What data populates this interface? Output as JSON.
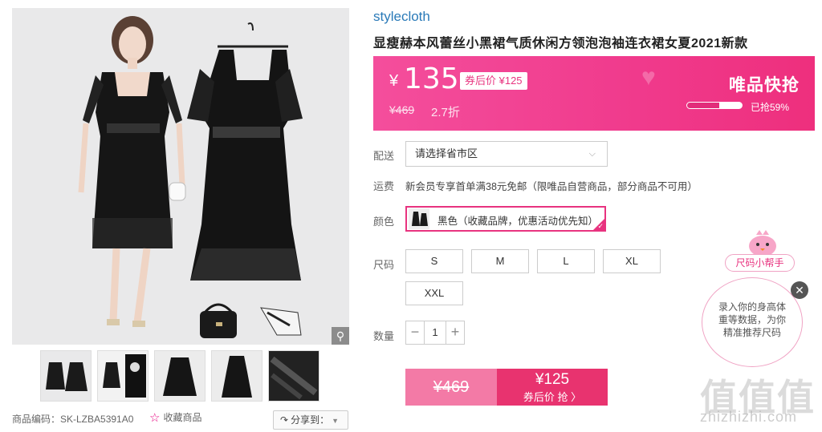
{
  "gallery": {
    "zoom_icon": "magnifier-icon",
    "product_code_label": "商品编码：SK-LZBA5391A0",
    "favorite_label": "收藏商品",
    "share_label": "分享到：",
    "thumbnail_count": 5
  },
  "product": {
    "brand": "stylecloth",
    "title": "显瘦赫本风蕾丝小黑裙气质休闲方领泡泡袖连衣裙女夏2021新款"
  },
  "price_banner": {
    "currency": "¥",
    "price": "135",
    "coupon_price": "券后价 ¥125",
    "original_price": "¥469",
    "discount": "2.7折",
    "promo_title": "唯品快抢",
    "sold_label": "已抢59%",
    "sold_fraction": 0.59,
    "accent": "#f03a8c"
  },
  "options": {
    "delivery_label": "配送",
    "delivery_select": "请选择省市区",
    "shipping_label": "运费",
    "shipping_text": "新会员专享首单满38元免邮（限唯品自营商品，部分商品不可用）",
    "color_label": "颜色",
    "color_value": "黑色（收藏品牌，优惠活动优先知）",
    "size_label": "尺码",
    "sizes": [
      "S",
      "M",
      "L",
      "XL",
      "XXL"
    ],
    "qty_label": "数量",
    "qty_value": "1"
  },
  "buy_button": {
    "original": "¥469",
    "price": "¥125",
    "action": "券后价 抢 〉"
  },
  "size_helper": {
    "title": "尺码小帮手",
    "line1": "录入你的身高体",
    "line2": "重等数据，为你",
    "line3": "精准推荐尺码",
    "close": "✕"
  },
  "watermark": {
    "glyphs": "值值值",
    "url": "zhizhizhi.com"
  }
}
